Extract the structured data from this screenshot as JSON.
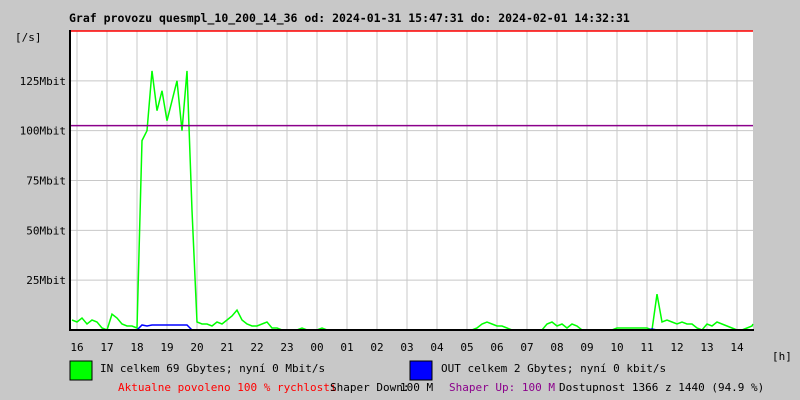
{
  "chart_data": {
    "type": "line",
    "title": "Graf provozu quesmpl_10_200_14_36 od: 2024-01-31 15:47:31 do: 2024-02-01 14:32:31",
    "ylabel": "[/s]",
    "xlabel": "[h]",
    "ylim": [
      0,
      150
    ],
    "y_unit": "Mbit",
    "y_ticks": [
      {
        "value": 25,
        "label": "25Mbit"
      },
      {
        "value": 50,
        "label": "50Mbit"
      },
      {
        "value": 75,
        "label": "75Mbit"
      },
      {
        "value": 100,
        "label": "100Mbit"
      },
      {
        "value": 125,
        "label": "125Mbit"
      }
    ],
    "x_ticks": [
      "16",
      "17",
      "18",
      "19",
      "20",
      "21",
      "22",
      "23",
      "00",
      "01",
      "02",
      "03",
      "04",
      "05",
      "06",
      "07",
      "08",
      "09",
      "10",
      "11",
      "12",
      "13",
      "14"
    ],
    "x_start": "15:50",
    "x_step_minutes": 10,
    "limit_line": {
      "value": 102.5,
      "color": "#8b008b"
    },
    "max_line_color": "#ff0000",
    "grid": true,
    "series": [
      {
        "name": "IN",
        "color": "#00ff00",
        "values": [
          5,
          4,
          6,
          3,
          5,
          4,
          1,
          0,
          8,
          6,
          3,
          2,
          2,
          1,
          95,
          100,
          130,
          110,
          120,
          105,
          115,
          125,
          100,
          130,
          60,
          4,
          3,
          3,
          2,
          4,
          3,
          5,
          7,
          10,
          5,
          3,
          2,
          2,
          3,
          4,
          1,
          1,
          0,
          0,
          0,
          0,
          1,
          0,
          0,
          0,
          1,
          0,
          0,
          0,
          0,
          0,
          0,
          0,
          0,
          0,
          0,
          0,
          0,
          0,
          0,
          0,
          0,
          0,
          0,
          0,
          0,
          0,
          0,
          0,
          0,
          0,
          0,
          0,
          0,
          0,
          0,
          1,
          3,
          4,
          3,
          2,
          2,
          1,
          0,
          0,
          0,
          0,
          0,
          0,
          0,
          3,
          4,
          2,
          3,
          1,
          3,
          2,
          0,
          0,
          0,
          0,
          0,
          0,
          0,
          1,
          1,
          1,
          1,
          1,
          1,
          1,
          0,
          18,
          4,
          5,
          4,
          3,
          4,
          3,
          3,
          1,
          0,
          3,
          2,
          4,
          3,
          2,
          1,
          0,
          0,
          1,
          2,
          3
        ]
      },
      {
        "name": "OUT",
        "color": "#0000ff",
        "values": [
          0,
          0,
          0,
          0,
          0,
          0,
          0,
          0,
          0,
          0,
          0,
          0,
          0,
          0,
          2.5,
          2,
          2.5,
          2.5,
          2.5,
          2.5,
          2.5,
          2.5,
          2.5,
          2.5,
          0,
          0,
          0,
          0,
          0,
          0,
          0,
          0,
          0,
          0,
          0,
          0,
          0,
          0,
          0,
          0,
          0,
          0,
          0,
          0,
          0,
          0,
          0,
          0,
          0,
          0,
          0,
          0,
          0,
          0,
          0,
          0,
          0,
          0,
          0,
          0,
          0,
          0,
          0,
          0,
          0,
          0,
          0,
          0,
          0,
          0,
          0,
          0,
          0,
          0,
          0,
          0,
          0,
          0,
          0,
          0,
          0,
          0,
          0,
          0,
          0,
          0,
          0,
          0,
          0,
          0,
          0,
          0,
          0,
          0,
          0,
          0,
          0,
          0,
          0,
          0,
          0,
          0,
          0,
          0,
          0,
          0,
          0,
          0,
          0,
          0,
          0,
          0,
          0,
          0,
          0,
          0,
          0.5,
          0,
          0,
          0,
          0,
          0,
          0,
          0,
          0,
          0,
          0,
          0,
          0,
          0,
          0,
          0,
          0,
          0,
          0,
          0,
          0,
          0
        ]
      }
    ]
  },
  "legend": {
    "in_text": "IN celkem 69 Gbytes; nyní 0 Mbit/s",
    "out_text": "OUT celkem 2 Gbytes; nyní 0 kbit/s"
  },
  "footer": {
    "allowed": "Aktualne povoleno 100 % rychlosti",
    "shaper_down_label": "Shaper Down:",
    "shaper_down_value": "100 M",
    "shaper_up": "Shaper Up: 100 M",
    "availability": "Dostupnost 1366 z 1440 (94.9 %)"
  },
  "colors": {
    "allowed": "#ff0000",
    "shaper_up": "#8b008b"
  }
}
